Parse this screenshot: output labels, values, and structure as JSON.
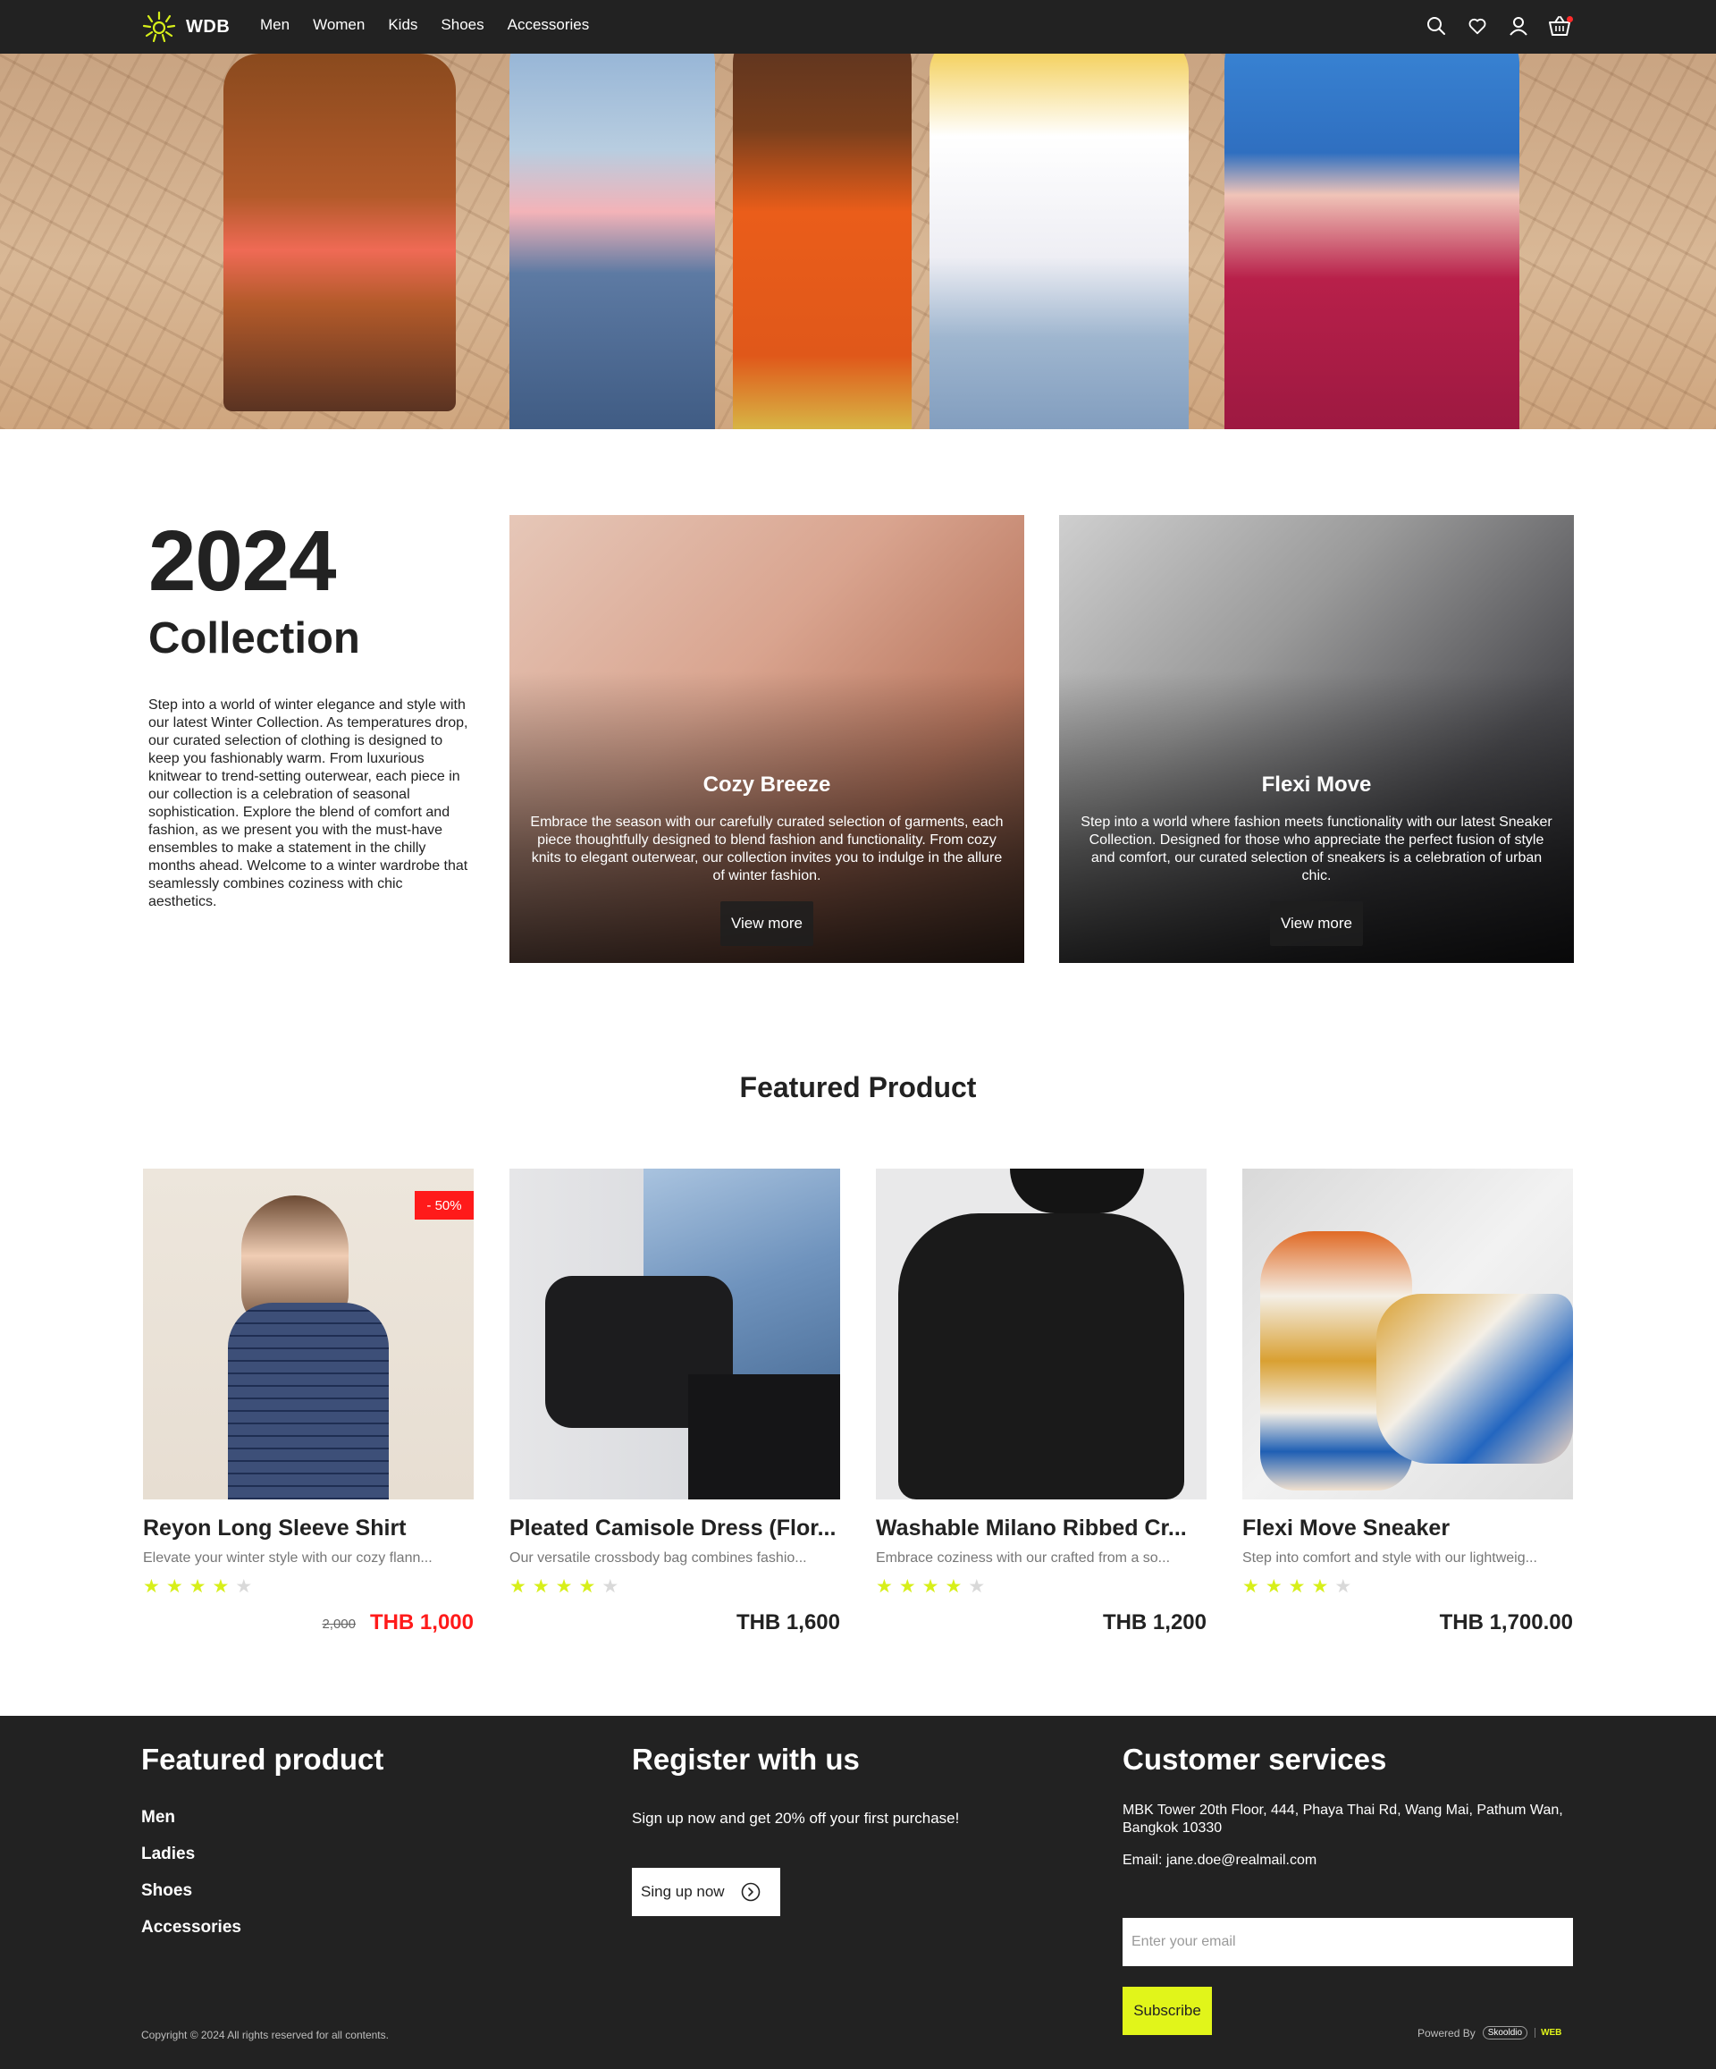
{
  "brand": {
    "name": "WDB"
  },
  "nav": {
    "links": [
      "Men",
      "Women",
      "Kids",
      "Shoes",
      "Accessories"
    ],
    "icons": [
      "search-icon",
      "heart-icon",
      "user-icon",
      "cart-icon"
    ]
  },
  "collection": {
    "year": "2024",
    "title": "Collection",
    "description": "Step into a world of winter elegance and style with our latest Winter Collection. As temperatures drop, our curated selection of clothing is designed to keep you fashionably warm. From luxurious knitwear to trend-setting outerwear, each piece in our collection is a celebration of seasonal sophistication. Explore the blend of comfort and fashion, as we present you with the must-have ensembles to make a statement in the chilly months ahead. Welcome to a winter wardrobe that seamlessly combines coziness with chic aesthetics.",
    "cards": [
      {
        "title": "Cozy Breeze",
        "text": "Embrace the season with our carefully curated selection of garments, each piece thoughtfully designed to blend fashion and functionality. From cozy knits to elegant outerwear, our collection invites you to indulge in the allure of winter fashion.",
        "button": "View more"
      },
      {
        "title": "Flexi Move",
        "text": "Step into a world where fashion meets functionality with our latest Sneaker Collection. Designed for those who appreciate the perfect fusion of style and comfort, our curated selection of sneakers is a celebration of urban chic.",
        "button": "View more"
      }
    ]
  },
  "featured": {
    "heading": "Featured Product",
    "products": [
      {
        "name": "Reyon Long Sleeve Shirt",
        "desc": "Elevate your winter style with our cozy flann...",
        "rating": 4,
        "price": "THB 1,000",
        "old_price": "2,000",
        "badge": "- 50%"
      },
      {
        "name": "Pleated Camisole Dress (Flor...",
        "desc": "Our versatile crossbody bag combines fashio...",
        "rating": 4,
        "price": "THB 1,600"
      },
      {
        "name": "Washable Milano Ribbed Cr...",
        "desc": "Embrace coziness with our crafted from a so...",
        "rating": 4,
        "price": "THB 1,200"
      },
      {
        "name": "Flexi Move Sneaker",
        "desc": "Step into comfort and style with our lightweig...",
        "rating": 4,
        "price": "THB 1,700.00"
      }
    ]
  },
  "footer": {
    "featured": {
      "title": "Featured product",
      "links": [
        "Men",
        "Ladies",
        "Shoes",
        "Accessories"
      ]
    },
    "register": {
      "title": "Register with us",
      "text": "Sign up now and get 20% off your first purchase!",
      "button": "Sing up now"
    },
    "customer": {
      "title": "Customer services",
      "address": "MBK Tower 20th Floor, 444, Phaya Thai Rd, Wang Mai, Pathum Wan, Bangkok 10330",
      "email": "Email: jane.doe@realmail.com",
      "input_placeholder": "Enter your email",
      "subscribe": "Subscribe"
    },
    "copyright": "Copyright © 2024 All rights reserved for all contents.",
    "powered": "Powered By",
    "powered_logo_1": "Skooldio",
    "powered_logo_2": "WEB"
  },
  "colors": {
    "dark": "#222222",
    "accent": "#e1f51a",
    "sale": "#ff1a1a",
    "star": "#d7ef1a"
  }
}
